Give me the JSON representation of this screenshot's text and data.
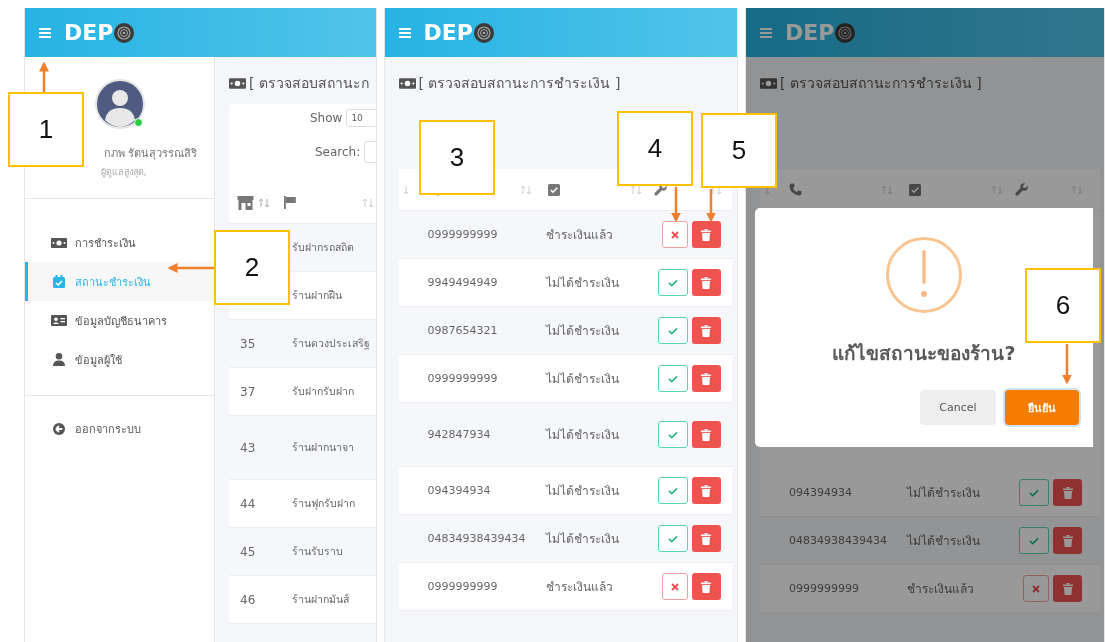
{
  "callouts": [
    {
      "number": "1"
    },
    {
      "number": "2"
    },
    {
      "number": "3"
    },
    {
      "number": "4"
    },
    {
      "number": "5"
    },
    {
      "number": "6"
    }
  ],
  "screen_1": {
    "logo": "DEP",
    "user": {
      "name": "กภพ รัตนสุวรรณสิริ",
      "role": "ผู้ดูแลสูงสุด,",
      "online": true
    },
    "menu": [
      {
        "label": "การชำระเงิน",
        "kind": "money",
        "selected": false
      },
      {
        "label": "สถานะชำระเงิน",
        "kind": "calendar",
        "selected": true
      },
      {
        "label": "ข้อมูลบัญชีธนาคาร",
        "kind": "idcard",
        "selected": false
      },
      {
        "label": "ข้อมูลผู้ใช้",
        "kind": "user",
        "selected": false
      }
    ],
    "logout": "ออกจากระบบ",
    "title": "[ ตรวจสอบสถานะก",
    "show_label": "Show",
    "show_value": "10",
    "search_label": "Search:",
    "rows": [
      {
        "name": "รับฝากรถสถิต"
      },
      {
        "name": "ร้านฝากฝืน"
      },
      {
        "id": "35",
        "name": "ร้านดวงประเสริฐ"
      },
      {
        "id": "37",
        "name": "รับฝากรับฝาก"
      },
      {
        "id": "43",
        "name": "ร้านฝากนาจา"
      },
      {
        "id": "44",
        "name": "ร้านฟุกรับฝาก"
      },
      {
        "id": "45",
        "name": "ร้านรับราบ"
      },
      {
        "id": "46",
        "name": "ร้านฝากมันส์"
      }
    ]
  },
  "screen_2": {
    "logo": "DEP",
    "title": "[ ตรวจสอบสถานะการชำระเงิน ]",
    "rows": [
      {
        "phone": "0999999999",
        "status": "ชำระเงินแล้ว",
        "paid": true
      },
      {
        "phone": "9949494949",
        "status": "ไม่ได้ชำระเงิน",
        "paid": false
      },
      {
        "phone": "0987654321",
        "status": "ไม่ได้ชำระเงิน",
        "paid": false
      },
      {
        "phone": "0999999999",
        "status": "ไม่ได้ชำระเงิน",
        "paid": false
      },
      {
        "phone": "942847934",
        "status": "ไม่ได้ชำระเงิน",
        "paid": false
      },
      {
        "phone": "094394934",
        "status": "ไม่ได้ชำระเงิน",
        "paid": false
      },
      {
        "phone": "04834938439434",
        "status": "ไม่ได้ชำระเงิน",
        "paid": false
      },
      {
        "phone": "0999999999",
        "status": "ชำระเงินแล้ว",
        "paid": true
      }
    ]
  },
  "screen_3": {
    "logo": "DEP",
    "title": "[ ตรวจสอบสถานะการชำระเงิน ]",
    "rows": [
      {
        "phone": "094394934",
        "status": "ไม่ได้ชำระเงิน",
        "paid": false
      },
      {
        "phone": "04834938439434",
        "status": "ไม่ได้ชำระเงิน",
        "paid": false
      },
      {
        "phone": "0999999999",
        "status": "ชำระเงินแล้ว",
        "paid": true
      }
    ],
    "dialog": {
      "title": "แก้ไขสถานะของร้าน?",
      "cancel": "Cancel",
      "confirm": "ยืนยัน"
    }
  }
}
